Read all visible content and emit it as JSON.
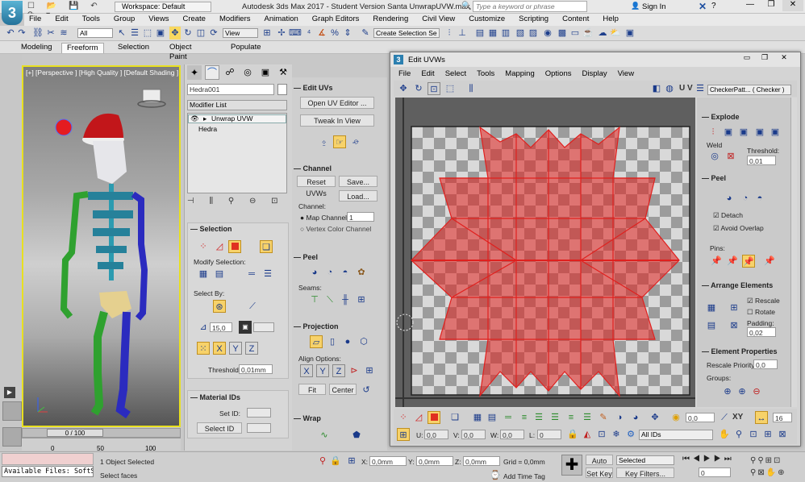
{
  "titlebar": {
    "app_logo": "3",
    "workspace": "Workspace: Default",
    "title": "Autodesk 3ds Max 2017 - Student Version   Santa UnwrapUVW.max",
    "search_placeholder": "Type a keyword or phrase",
    "signin": "Sign In",
    "help": "?"
  },
  "menu": [
    "File",
    "Edit",
    "Tools",
    "Group",
    "Views",
    "Create",
    "Modifiers",
    "Animation",
    "Graph Editors",
    "Rendering",
    "Civil View",
    "Customize",
    "Scripting",
    "Content",
    "Help"
  ],
  "main_toolbar": {
    "filter": "All",
    "view": "View",
    "create_selection_set": "Create Selection Se"
  },
  "ribbon_tabs": [
    "Modeling",
    "Freeform",
    "Selection",
    "Object Paint",
    "Populate"
  ],
  "viewport": {
    "label": "[+] [Perspective ] [High Quality ] [Default Shading ]"
  },
  "command_panel": {
    "object_name": "Hedra001",
    "modifier_list": "Modifier List",
    "stack": [
      "Unwrap UVW",
      "Hedra"
    ],
    "selection": {
      "title": "Selection",
      "modify_selection": "Modify Selection:",
      "select_by": "Select By:",
      "angle": "15,0",
      "threshold_label": "Threshold:",
      "threshold": "0,01mm"
    },
    "material_ids": {
      "title": "Material IDs",
      "set_id": "Set ID:",
      "select_id": "Select ID"
    },
    "edit_uvs": {
      "title": "Edit UVs",
      "open_editor": "Open UV Editor ...",
      "tweak": "Tweak In View"
    },
    "channel": {
      "title": "Channel",
      "reset": "Reset UVWs",
      "save": "Save...",
      "load": "Load...",
      "channel_label": "Channel:",
      "map_channel": "Map Channel:",
      "map_channel_value": "1",
      "vertex_color": "Vertex Color Channel"
    },
    "peel": {
      "title": "Peel",
      "seams": "Seams:"
    },
    "projection": {
      "title": "Projection",
      "align_options": "Align Options:",
      "x": "X",
      "y": "Y",
      "z": "Z",
      "fit": "Fit",
      "center": "Center"
    },
    "wrap": {
      "title": "Wrap"
    }
  },
  "uv_editor": {
    "title": "Edit UVWs",
    "menu": [
      "File",
      "Edit",
      "Select",
      "Tools",
      "Mapping",
      "Options",
      "Display",
      "View"
    ],
    "uv_label": "U V",
    "checker": "CheckerPatt... ( Checker )",
    "explode": {
      "title": "Explode",
      "weld": "Weld",
      "threshold_label": "Threshold:",
      "threshold": "0,01"
    },
    "peel": {
      "title": "Peel",
      "detach": "Detach",
      "avoid_overlap": "Avoid Overlap",
      "pins": "Pins:"
    },
    "arrange": {
      "title": "Arrange Elements",
      "rescale": "Rescale",
      "rotate": "Rotate",
      "padding_label": "Padding:",
      "padding": "0,02"
    },
    "element_properties": {
      "title": "Element Properties",
      "rescale_priority": "Rescale Priority:",
      "rescale_priority_value": "0,0",
      "groups": "Groups:"
    },
    "bottom": {
      "angle_value": "0,0",
      "u": "U:",
      "v": "V:",
      "w": "W:",
      "u_val": "0,0",
      "v_val": "0,0",
      "w_val": "0,0",
      "l": "L:",
      "l_val": "0",
      "xy": "XY",
      "num": "16",
      "all_ids": "All IDs",
      "zero": "0,0"
    }
  },
  "timeline": {
    "frame": "0 / 100",
    "ticks": [
      "0",
      "50",
      "100"
    ]
  },
  "status": {
    "listener": "Available Files: SoftS",
    "selected": "1 Object Selected",
    "prompt": "Select faces",
    "x_label": "X:",
    "x": "0,0mm",
    "y_label": "Y:",
    "y": "0,0mm",
    "z_label": "Z:",
    "z": "0,0mm",
    "grid": "Grid = 0,0mm",
    "add_time_tag": "Add Time Tag",
    "auto_key": "Auto Key",
    "selected_dd": "Selected",
    "set_key": "Set Key",
    "key_filters": "Key Filters...",
    "frame": "0"
  },
  "colors": {
    "uv_red": "#e0201e",
    "viewport_border": "#e8e020",
    "title_blue": "#1c4fa0"
  }
}
